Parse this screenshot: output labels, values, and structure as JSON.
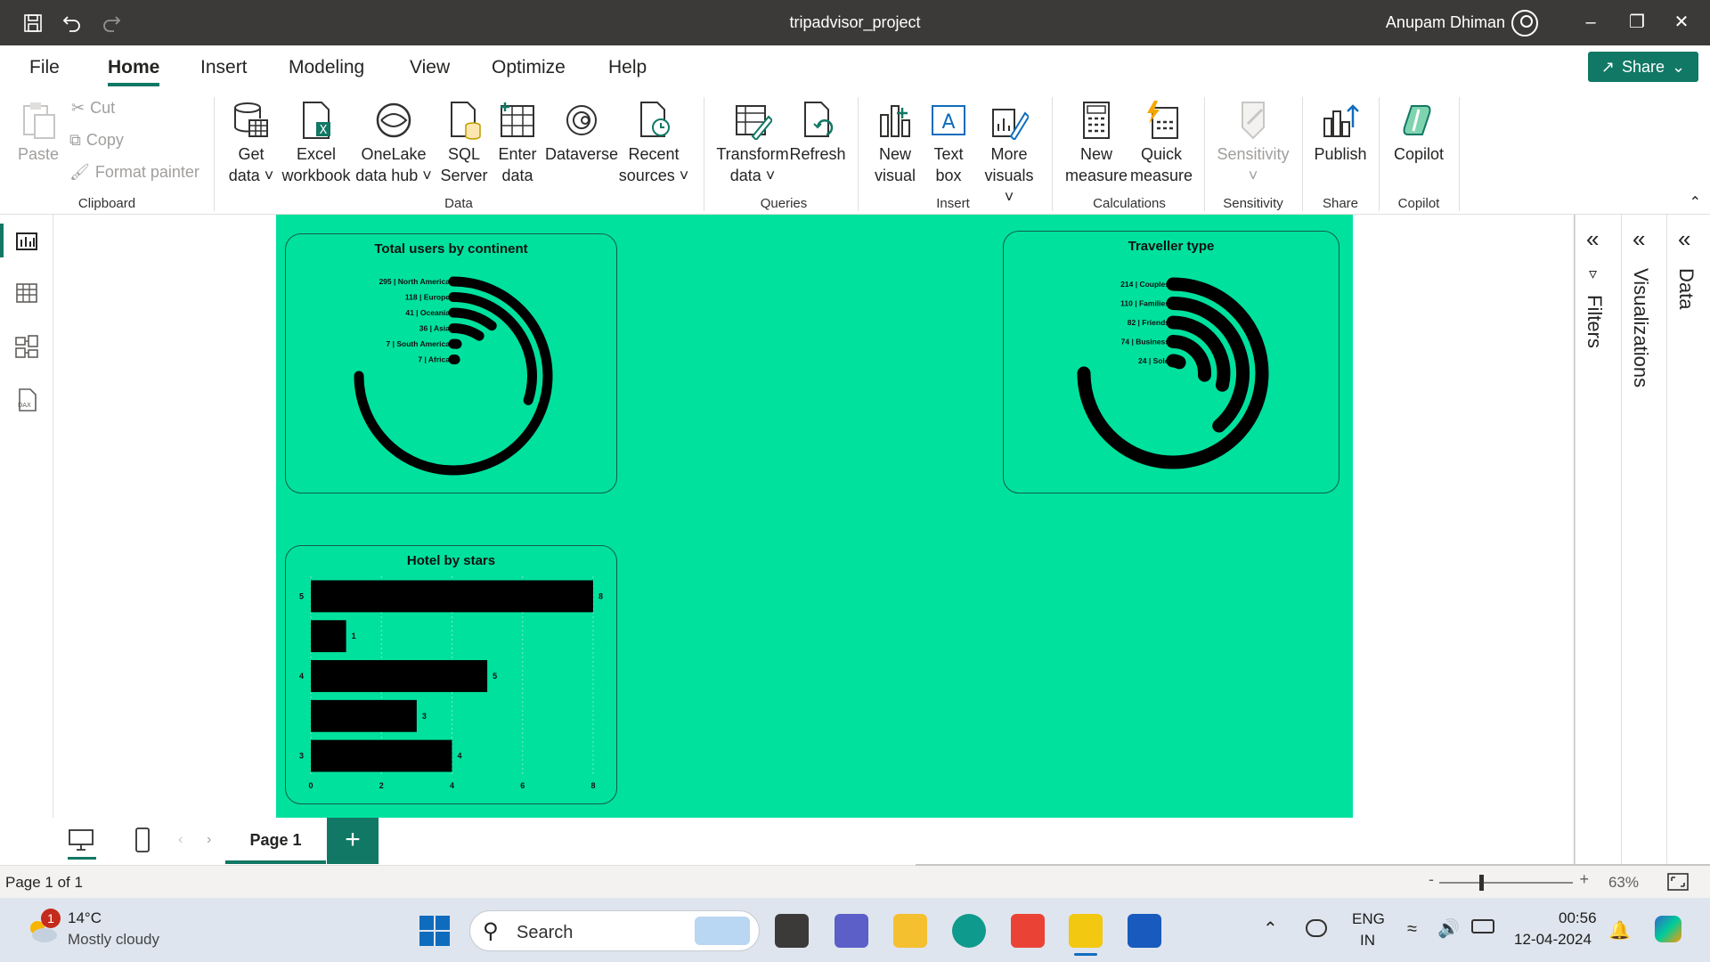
{
  "window": {
    "title": "tripadvisor_project",
    "user": "Anupam Dhiman"
  },
  "menu": {
    "tabs": [
      "File",
      "Home",
      "Insert",
      "Modeling",
      "View",
      "Optimize",
      "Help"
    ],
    "active": "Home",
    "share_label": "Share"
  },
  "ribbon": {
    "clipboard": {
      "paste": "Paste",
      "cut": "Cut",
      "copy": "Copy",
      "format_painter": "Format painter",
      "group": "Clipboard"
    },
    "data": {
      "get_data": [
        "Get",
        "data"
      ],
      "excel": [
        "Excel",
        "workbook"
      ],
      "onelake": [
        "OneLake",
        "data hub"
      ],
      "sql": [
        "SQL",
        "Server"
      ],
      "enter": [
        "Enter",
        "data"
      ],
      "dataverse": "Dataverse",
      "recent": [
        "Recent",
        "sources"
      ],
      "group": "Data"
    },
    "queries": {
      "transform": [
        "Transform",
        "data"
      ],
      "refresh": "Refresh",
      "group": "Queries"
    },
    "insert": {
      "new_visual": [
        "New",
        "visual"
      ],
      "text_box": [
        "Text",
        "box"
      ],
      "more_visuals": [
        "More",
        "visuals"
      ],
      "group": "Insert"
    },
    "calculations": {
      "new_measure": [
        "New",
        "measure"
      ],
      "quick_measure": [
        "Quick",
        "measure"
      ],
      "group": "Calculations"
    },
    "sensitivity": {
      "label": "Sensitivity",
      "group": "Sensitivity"
    },
    "share": {
      "publish": "Publish",
      "group": "Share"
    },
    "copilot": {
      "label": "Copilot",
      "group": "Copilot"
    }
  },
  "panes": {
    "filters": "Filters",
    "visualizations": "Visualizations",
    "data": "Data"
  },
  "pages": {
    "current": "Page 1",
    "status": "Page 1 of 1",
    "zoom": "63%"
  },
  "chart_data": [
    {
      "type": "radial-bar",
      "title": "Total users by continent",
      "categories": [
        "North America",
        "Europe",
        "Oceania",
        "Asia",
        "South America",
        "Africa"
      ],
      "values": [
        295,
        118,
        41,
        36,
        7,
        7
      ],
      "labels": [
        "295 | North America",
        "118 | Europe",
        "41 | Oceania",
        "36 | Asia",
        "7 | South America",
        "7 | Africa"
      ],
      "max": 295
    },
    {
      "type": "radial-bar",
      "title": "Traveller type",
      "categories": [
        "Couples",
        "Families",
        "Friends",
        "Business",
        "Solo"
      ],
      "values": [
        214,
        110,
        82,
        74,
        24
      ],
      "labels": [
        "214 | Couples",
        "110 | Families",
        "82 | Friends",
        "74 | Business",
        "24 | Solo"
      ],
      "max": 214
    },
    {
      "type": "bar",
      "orientation": "horizontal",
      "title": "Hotel by stars",
      "categories": [
        "5",
        "",
        "4",
        "",
        "3"
      ],
      "values": [
        8,
        1,
        5,
        3,
        4
      ],
      "xlim": [
        0,
        8
      ],
      "xticks": [
        "0",
        "2",
        "4",
        "6",
        "8"
      ],
      "grid": true
    }
  ],
  "taskbar": {
    "weather_temp": "14°C",
    "weather_desc": "Mostly cloudy",
    "weather_badge": "1",
    "search": "Search",
    "lang1": "ENG",
    "lang2": "IN",
    "time": "00:56",
    "date": "12-04-2024"
  },
  "colors": {
    "accent": "#117865",
    "canvas": "#00e19e",
    "marks": "#000000",
    "titlebar": "#3b3a39"
  }
}
